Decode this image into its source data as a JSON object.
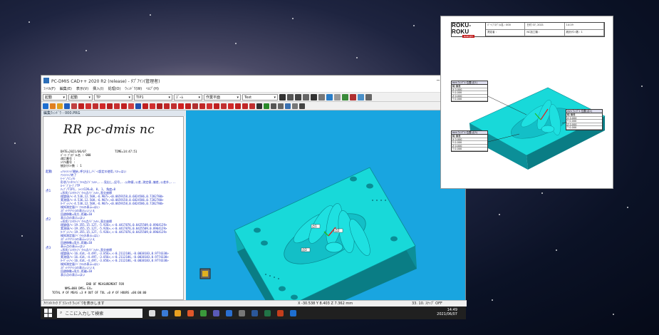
{
  "window": {
    "title": "PC-DMIS CAD++ 2020 R2 (release) - ﾀﾌﾟｱｲﾝ(管理者)",
    "minimize": "─",
    "maximize": "☐",
    "close": "✕"
  },
  "menu": [
    "ﾌｧｲﾙ(F)",
    "編集(E)",
    "表示(V)",
    "挿入(I)",
    "処理(O)",
    "ｳｨﾝﾄﾞｳ(W)",
    "ﾍﾙﾌﾟ(H)"
  ],
  "toolbar": {
    "combo_mode": "起動",
    "combo_align": "起動",
    "combo_probe": "TP",
    "combo_tip": "TIP1",
    "combo_clearance": "ｽﾞｰﾑ",
    "combo_workplane": "作業平面",
    "combo_text": "Text"
  },
  "editor": {
    "panel_title": "編集ｳｨﾝﾄﾞｳ - 000.PRG",
    "logo_text": "RR pc-dmis nc",
    "header_date": "DATE=2021/06/07",
    "header_time": "TIME=14:47:51",
    "header_part": "ﾊﾟｰﾄ･ﾌﾟﾛｸﾞﾗﾑ名 : 000",
    "header_rev": "改訂番号 :",
    "header_serial": "ｼﾘｱﾙ番号 :",
    "header_count": "統計ｶｳﾝﾄ数 : 1",
    "gutter_1": "起動",
    "gutter_2": "点1",
    "gutter_3": "点2",
    "gutter_4": "点3",
    "lines": [
      "=ｱﾗｲﾒﾝﾄ/開始,呼び出し/ﾍﾞｰｽ設定の使用,ﾘｽﾄ=はい",
      "ｱﾗｲﾒﾝﾄ/終了",
      "ﾓｰﾄﾞ/ﾏﾆｭｱﾙ",
      "形状/ｺﾝﾀｸﾄ/ﾍﾞｸﾄﾙ点/ﾃﾞﾌｫﾙﾄ,...見出し,記号,..公称値,公差,測定値,偏差,公差外,...",
      "ﾛｰﾄﾞﾌﾟﾛｰﾌﾞ/TP",
      "ﾁｯﾌﾟ/TIP1, ｼｬﾝｸIJK=0, 0, 1, 角度=0",
      "=形状/ｺﾝﾀｸﾄ/ﾍﾞｸﾄﾙ点/ﾃﾞﾌｫﾙﾄ,直交座標",
      "理論値/<-4.536,12.508,-6.907>,<0.0659158,0.6824586,0.7282780>",
      "実測値/<-4.536,12.508,-6.907>,<0.0659158,0.6824586,0.7282780>",
      "ﾀｰｹﾞｯﾄ/<-4.536,12.508,-6.907>,<0.0659158,0.6824586,0.7282780>",
      "検知測定量/ﾍﾞｸﾄﾙの表示=はい",
      "ｽﾎﾟｯﾄｸﾘｱﾗﾝｽの表示=いいえ",
      "回避移動=両方,距離=10",
      "表示点の表示=はい",
      "=形状/ｺﾝﾀｸﾄ/ﾍﾞｸﾄﾙ点/ﾃﾞﾌｫﾙﾄ,直交座標",
      "理論値/<-19.355,15.127,-5.926>,<-0.4417876,0.0425509,0.8964129>",
      "実測値/<-19.355,15.127,-5.926>,<-0.4417876,0.0425509,0.8964129>",
      "ﾀｰｹﾞｯﾄ/<-19.355,15.127,-5.926>,<-0.4417876,0.0425509,0.8964129>",
      "検知測定量/ﾍﾞｸﾄﾙの表示=はい",
      "ｽﾎﾟｯﾄｸﾘｱﾗﾝｽの表示=いいえ",
      "回避移動=両方,距離=10",
      "表示点の表示=はい",
      "=形状/ｺﾝﾀｸﾄ/ﾍﾞｸﾄﾙ点/ﾃﾞﾌｫﾙﾄ,直交座標",
      "理論値/<-16.414,-4.497,-3.856>,<-0.2112186,-0.0038183,0.9774338>",
      "実測値/<-16.414,-4.497,-3.856>,<-0.2112186,-0.0038183,0.9774338>",
      "ﾀｰｹﾞｯﾄ/<-16.414,-4.497,-3.856>,<-0.2112186,-0.0038183,0.9774338>",
      "検知測定量/ﾍﾞｸﾄﾙの表示=はい",
      "ｽﾎﾟｯﾄｸﾘｱﾗﾝｽの表示=いいえ",
      "回避移動=両方,距離=10",
      "表示点の表示=はい"
    ],
    "footer_title": "END OF MEASUREMENT FOR",
    "footer_counts": "NMS=000              DMS=                 EX=",
    "footer_totals": "TOTAL # OF MEAS =3       # OUT OF TOL =0       # OF HOURS =00:00:00"
  },
  "statusbar": {
    "left": "ｱｲｿﾒﾄﾘｯｸ ｸﾞﾗﾌｨｯｸ ｳｨﾝﾄﾞｳを表示します",
    "coords": "X -30.538   Y 8.403   Z 7.362   mm",
    "right": "33.   10.   ｽﾅｯﾌﾟ   OFF"
  },
  "taskbar": {
    "search_placeholder": "ここに入力して検索",
    "time": "14:49",
    "date": "2021/06/07"
  },
  "labels": {
    "point1": "点1",
    "point2": "点2",
    "point3": "点3"
  },
  "report": {
    "brand": "ROKU-ROKU",
    "brand_sub": "NANOJET",
    "cells": [
      "ﾊﾟｰﾄﾌﾟﾛｸﾞﾗﾑ名 : 000",
      "日付 07, 2021",
      "14:19",
      "測定者 :",
      "NC加工機 :",
      "統計ｶｳﾝﾄ数 : 1"
    ],
    "box_head": "mm ｳｨﾝｸﾞﾙ 位置(点1)",
    "box_head2": "mm ｳｨﾝｸﾞﾙ 位置(点2)",
    "box_head3": "mm ｳｨﾝｸﾞﾙ 位置(点3)",
    "row_axis": "軸 偏差",
    "row_x": "X  0.000",
    "row_y": "Y  0.000",
    "row_z": "Z  0.000",
    "row_t": "T  0.000"
  },
  "colors": {
    "viewport_bg": "#19a5e0",
    "part": "#16d6d6",
    "editor_blue": "#1a2cc0"
  }
}
